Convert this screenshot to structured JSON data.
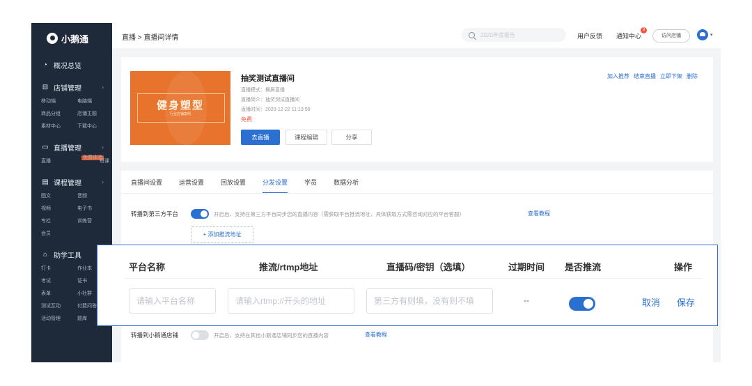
{
  "app": {
    "logo_text": "小鹅通"
  },
  "sidebar": {
    "overview": "概况总览",
    "store": {
      "title": "店铺管理",
      "items": [
        "移动端",
        "电脑端",
        "商品分组",
        "店铺主题",
        "素材中心",
        "下载中心"
      ]
    },
    "live": {
      "title": "直播管理",
      "items": [
        "直播",
        "班课"
      ],
      "badge": "免费体验"
    },
    "course": {
      "title": "课程管理",
      "items": [
        "图文",
        "音频",
        "视频",
        "电子书",
        "专栏",
        "训练营",
        "会员"
      ]
    },
    "tools": {
      "title": "助学工具",
      "items": [
        "打卡",
        "作业本",
        "考试",
        "证书",
        "表单",
        "小社群",
        "测试互动",
        "付费问答",
        "活动管理",
        "题库"
      ]
    }
  },
  "topbar": {
    "breadcrumb": "直播 > 直播间详情",
    "search_placeholder": "2020年度报告",
    "feedback": "用户反馈",
    "notifications": "通知中心",
    "notif_count": "9",
    "visit_store": "访问店铺"
  },
  "live_card": {
    "cover_title": "健身塑型",
    "cover_subtitle": "行业店铺案例",
    "title": "抽奖测试直播间",
    "mode": "直播模式：横屏直播",
    "intro": "直播简介：抽奖测试直播间",
    "time": "直播时间：2020-12-22 11:13:56",
    "price": "免费",
    "btn_go_live": "去直播",
    "btn_edit": "课程编辑",
    "btn_share": "分享",
    "actions": [
      "加入推荐",
      "结束直播",
      "立即下架",
      "删除"
    ]
  },
  "tabs": [
    "直播间设置",
    "运营设置",
    "回放设置",
    "分发设置",
    "学员",
    "数据分析"
  ],
  "active_tab": "分发设置",
  "distribution": {
    "third_party_label": "转播到第三方平台",
    "third_party_hint": "开启后，支持在第三方平台同步您的直播内容（需获取平台推流地址，具体获取方式需咨询对应的平台客服）",
    "third_party_link": "查看教程",
    "third_party_enabled": true,
    "add_url": "+ 添加推流地址",
    "xet_label": "转播到小鹅通店铺",
    "xet_hint": "开启后，支持在其他小鹅通店铺同步您的直播内容",
    "xet_link": "查看教程",
    "xet_enabled": false
  },
  "push_table": {
    "headers": [
      "平台名称",
      "推流/rtmp地址",
      "直播码/密钥（选填）",
      "过期时间",
      "是否推流",
      "操作"
    ],
    "platform_placeholder": "请输入平台名称",
    "rtmp_placeholder": "请输入rtmp://开头的地址",
    "key_placeholder": "第三方有则填，没有则不填",
    "expire": "--",
    "push_enabled": true,
    "cancel": "取消",
    "save": "保存"
  }
}
